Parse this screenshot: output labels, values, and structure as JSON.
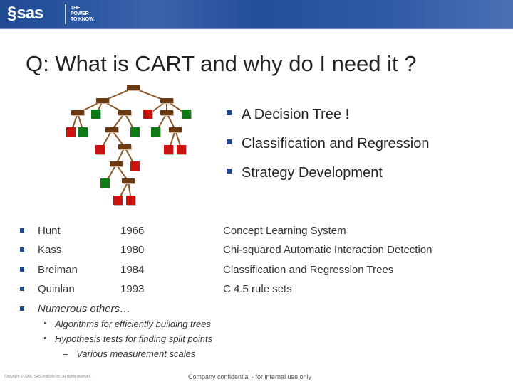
{
  "header": {
    "logo_text": "sas",
    "tagline": [
      "THE",
      "POWER",
      "TO KNOW."
    ],
    "brand_color": "#1f4a92"
  },
  "title": "Q: What is CART and why do I need it ?",
  "right_bullets": [
    "A Decision Tree !",
    "Classification and Regression",
    "Strategy Development"
  ],
  "history": [
    {
      "name": "Hunt",
      "year": "1966",
      "desc": "Concept Learning System"
    },
    {
      "name": "Kass",
      "year": "1980",
      "desc": "Chi-squared Automatic Interaction Detection"
    },
    {
      "name": "Breiman",
      "year": "1984",
      "desc": "Classification and Regression Trees"
    },
    {
      "name": "Quinlan",
      "year": "1993",
      "desc": "C 4.5 rule sets"
    }
  ],
  "others": {
    "label": "Numerous others…",
    "sub_items": [
      "Algorithms for efficiently building trees",
      "Hypothesis tests for finding split points"
    ],
    "sub_sub_items": [
      "Various measurement scales"
    ]
  },
  "tree_illustration": {
    "colors": {
      "node": "#6b3a10",
      "edge": "#8b5a2b",
      "class_a": "#cc1111",
      "class_b": "#0e7a16"
    },
    "nodes": [
      {
        "id": "root",
        "type": "split"
      },
      {
        "id": "L",
        "type": "split",
        "parent": "root"
      },
      {
        "id": "R",
        "type": "split",
        "parent": "root"
      },
      {
        "id": "LL",
        "type": "split",
        "parent": "L"
      },
      {
        "id": "Lg",
        "type": "leaf",
        "class": "b",
        "parent": "L"
      },
      {
        "id": "LR",
        "type": "split",
        "parent": "L"
      },
      {
        "id": "Rr",
        "type": "leaf",
        "class": "a",
        "parent": "R"
      },
      {
        "id": "RM",
        "type": "split",
        "parent": "R"
      },
      {
        "id": "Rg",
        "type": "leaf",
        "class": "b",
        "parent": "R"
      },
      {
        "id": "LLr",
        "type": "leaf",
        "class": "a",
        "parent": "LL"
      },
      {
        "id": "LLg",
        "type": "leaf",
        "class": "b",
        "parent": "LL"
      },
      {
        "id": "LRn",
        "type": "split",
        "parent": "LR"
      },
      {
        "id": "LRg",
        "type": "leaf",
        "class": "b",
        "parent": "LR"
      },
      {
        "id": "RMg",
        "type": "leaf",
        "class": "b",
        "parent": "RM"
      },
      {
        "id": "RMn",
        "type": "split",
        "parent": "RM"
      },
      {
        "id": "LRnr",
        "type": "leaf",
        "class": "a",
        "parent": "LRn"
      },
      {
        "id": "LRnn",
        "type": "split",
        "parent": "LRn"
      },
      {
        "id": "RMnr1",
        "type": "leaf",
        "class": "a",
        "parent": "RMn"
      },
      {
        "id": "RMnr2",
        "type": "leaf",
        "class": "a",
        "parent": "RMn"
      },
      {
        "id": "D1",
        "type": "split",
        "parent": "LRnn"
      },
      {
        "id": "D1r",
        "type": "leaf",
        "class": "a",
        "parent": "LRnn"
      },
      {
        "id": "D2g",
        "type": "leaf",
        "class": "b",
        "parent": "D1"
      },
      {
        "id": "D2",
        "type": "split",
        "parent": "D1"
      },
      {
        "id": "D3r1",
        "type": "leaf",
        "class": "a",
        "parent": "D2"
      },
      {
        "id": "D3r2",
        "type": "leaf",
        "class": "a",
        "parent": "D2"
      }
    ]
  },
  "footer": {
    "copyright": "Copyright © 2006, SAS Institute Inc. All rights reserved.",
    "confidential": "Company confidential - for internal use only"
  }
}
